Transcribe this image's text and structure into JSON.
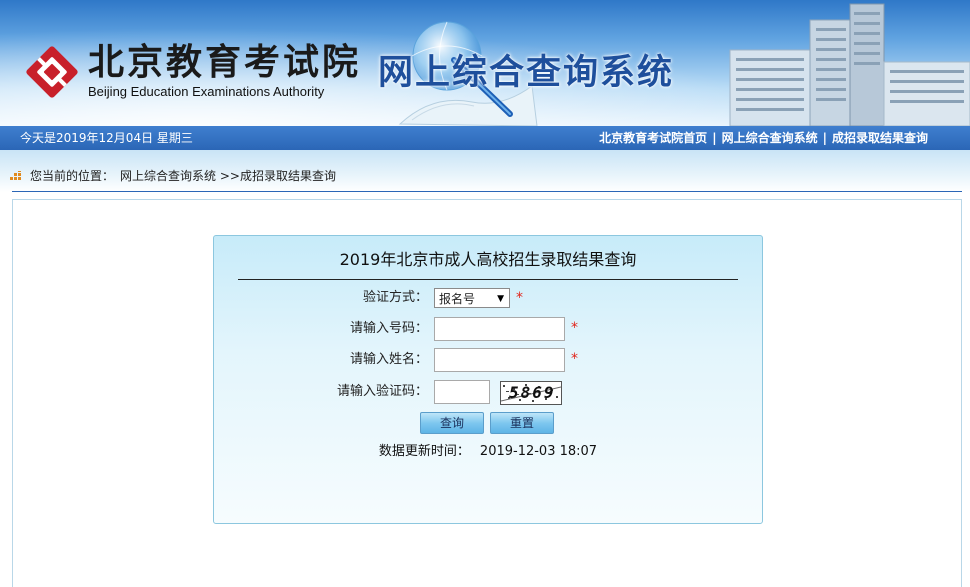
{
  "header": {
    "logo_cn": "北京教育考试院",
    "logo_en": "Beijing Education Examinations Authority",
    "system_title": "网上综合查询系统"
  },
  "navbar": {
    "date": "今天是2019年12月04日  星期三",
    "links": [
      "北京教育考试院首页",
      "网上综合查询系统",
      "成招录取结果查询"
    ],
    "separator": "|"
  },
  "breadcrumb": {
    "prefix": "您当前的位置：",
    "path": "网上综合查询系统 >>成招录取结果查询"
  },
  "form": {
    "title": "2019年北京市成人高校招生录取结果查询",
    "verify_label": "验证方式：",
    "verify_selected": "报名号",
    "number_label": "请输入号码：",
    "number_value": "",
    "name_label": "请输入姓名：",
    "name_value": "",
    "captcha_label": "请输入验证码：",
    "captcha_value": "",
    "captcha_text": "5869",
    "required_mark": "*",
    "submit_label": "查询",
    "reset_label": "重置",
    "update_label": "数据更新时间：",
    "update_value": "2019-12-03 18:07"
  },
  "colors": {
    "navbar": "#2b66b6",
    "required": "#e1251b",
    "title_blue": "#1e4f9c",
    "logo_red": "#c8202a"
  },
  "icons": {
    "logo": "education-authority-logo-icon",
    "breadcrumb": "location-grid-icon",
    "select_arrow": "dropdown-arrow-icon"
  }
}
